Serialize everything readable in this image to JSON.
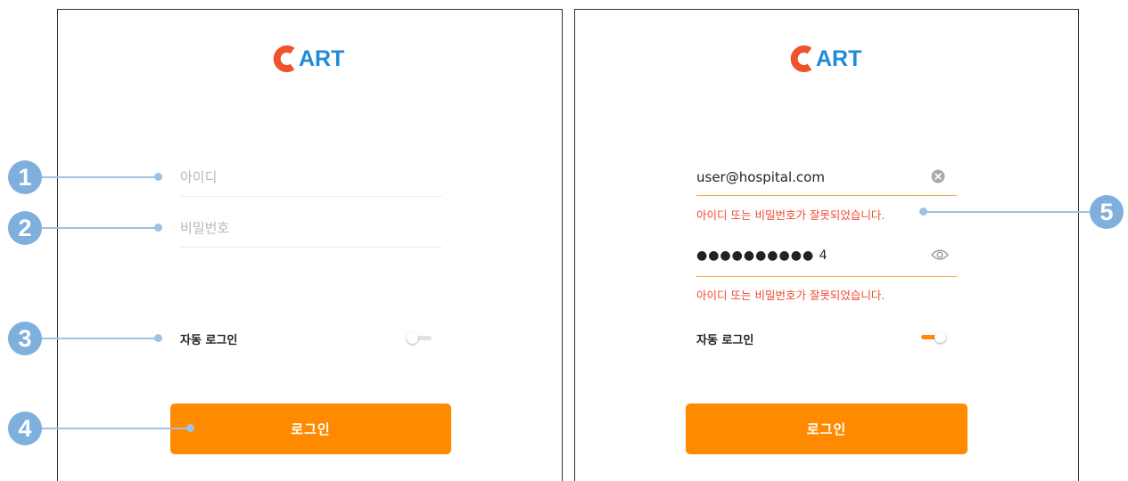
{
  "brand": {
    "logo_text": "ART",
    "logo_color": "#1f8ad6",
    "mark_color": "#f0522d"
  },
  "left_panel": {
    "id_field": {
      "placeholder": "아이디"
    },
    "password_field": {
      "placeholder": "비밀번호"
    },
    "auto_login": {
      "label": "자동 로그인",
      "enabled": false
    },
    "login_button": {
      "label": "로그인"
    }
  },
  "right_panel": {
    "id_field": {
      "value": "user@hospital.com",
      "clear_icon": "clear-circle-icon"
    },
    "id_error": "아이디 또는 비밀번호가 잘못되었습니다.",
    "password_field": {
      "value": "●●●●●●●●●● 4",
      "reveal_icon": "eye-icon"
    },
    "password_error": "아이디 또는 비밀번호가 잘못되었습니다.",
    "auto_login": {
      "label": "자동 로그인",
      "enabled": true
    },
    "login_button": {
      "label": "로그인"
    }
  },
  "callouts": [
    "1",
    "2",
    "3",
    "4",
    "5"
  ],
  "colors": {
    "accent": "#ff8a00",
    "error": "#f04a32",
    "callout": "#7fb0dd"
  }
}
